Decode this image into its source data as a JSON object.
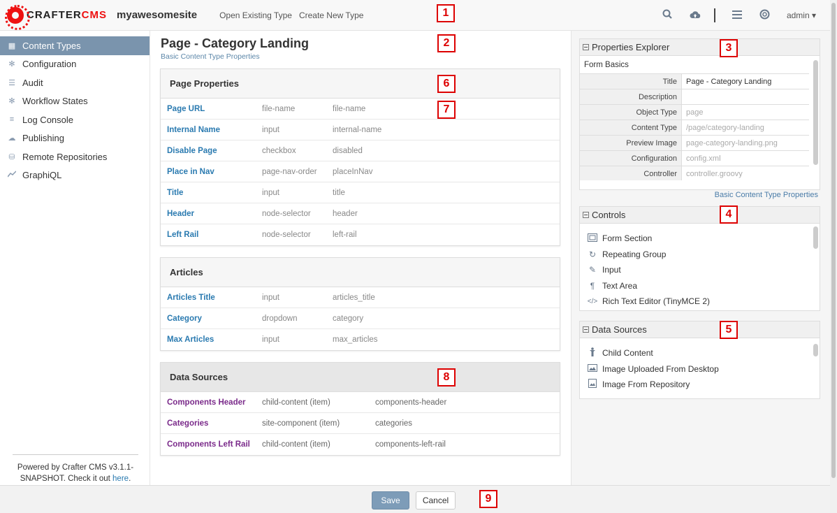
{
  "topbar": {
    "logo_crafter": "CRAFTER",
    "logo_cms": "CMS",
    "site_name": "myawesomesite",
    "links": [
      "Open Existing Type",
      "Create New Type"
    ],
    "user": "admin"
  },
  "sidebar": {
    "items": [
      {
        "label": "Content Types",
        "icon": "grid-icon"
      },
      {
        "label": "Configuration",
        "icon": "gear-icon"
      },
      {
        "label": "Audit",
        "icon": "list-icon"
      },
      {
        "label": "Workflow States",
        "icon": "gear-icon"
      },
      {
        "label": "Log Console",
        "icon": "log-icon"
      },
      {
        "label": "Publishing",
        "icon": "cloud-upload-icon"
      },
      {
        "label": "Remote Repositories",
        "icon": "database-icon"
      },
      {
        "label": "GraphiQL",
        "icon": "chart-line-icon"
      }
    ],
    "footer_text": "Powered by Crafter CMS v3.1.1-SNAPSHOT. Check it out",
    "footer_link": "here",
    "footer_end": "."
  },
  "main": {
    "title": "Page - Category Landing",
    "subtitle": "Basic Content Type Properties",
    "sections": [
      {
        "title": "Page Properties",
        "rows": [
          [
            "Page URL",
            "file-name",
            "file-name"
          ],
          [
            "Internal Name",
            "input",
            "internal-name"
          ],
          [
            "Disable Page",
            "checkbox",
            "disabled"
          ],
          [
            "Place in Nav",
            "page-nav-order",
            "placeInNav"
          ],
          [
            "Title",
            "input",
            "title"
          ],
          [
            "Header",
            "node-selector",
            "header"
          ],
          [
            "Left Rail",
            "node-selector",
            "left-rail"
          ]
        ]
      },
      {
        "title": "Articles",
        "rows": [
          [
            "Articles Title",
            "input",
            "articles_title"
          ],
          [
            "Category",
            "dropdown",
            "category"
          ],
          [
            "Max Articles",
            "input",
            "max_articles"
          ]
        ]
      }
    ],
    "datasources": {
      "title": "Data Sources",
      "rows": [
        [
          "Components Header",
          "child-content (item)",
          "components-header"
        ],
        [
          "Categories",
          "site-component (item)",
          "categories"
        ],
        [
          "Components Left Rail",
          "child-content (item)",
          "components-left-rail"
        ]
      ]
    }
  },
  "right": {
    "properties": {
      "title": "Properties Explorer",
      "group": "Form Basics",
      "rows": [
        {
          "label": "Title",
          "value": "Page - Category Landing"
        },
        {
          "label": "Description",
          "value": ""
        },
        {
          "label": "Object Type",
          "value": "page"
        },
        {
          "label": "Content Type",
          "value": "/page/category-landing"
        },
        {
          "label": "Preview Image",
          "value": "page-category-landing.png"
        },
        {
          "label": "Configuration",
          "value": "config.xml"
        },
        {
          "label": "Controller",
          "value": "controller.groovy"
        }
      ],
      "link": "Basic Content Type Properties"
    },
    "controls": {
      "title": "Controls",
      "items": [
        {
          "label": "Form Section",
          "icon": "form-section-icon"
        },
        {
          "label": "Repeating Group",
          "icon": "repeat-icon"
        },
        {
          "label": "Input",
          "icon": "edit-icon"
        },
        {
          "label": "Text Area",
          "icon": "paragraph-icon"
        },
        {
          "label": "Rich Text Editor (TinyMCE 2)",
          "icon": "code-icon"
        }
      ]
    },
    "datasources": {
      "title": "Data Sources",
      "items": [
        {
          "label": "Child Content",
          "icon": "child-icon"
        },
        {
          "label": "Image Uploaded From Desktop",
          "icon": "image-icon"
        },
        {
          "label": "Image From Repository",
          "icon": "image-file-icon"
        }
      ]
    }
  },
  "bottom": {
    "save": "Save",
    "cancel": "Cancel"
  },
  "markers": [
    "1",
    "2",
    "3",
    "4",
    "5",
    "6",
    "7",
    "8",
    "9"
  ]
}
